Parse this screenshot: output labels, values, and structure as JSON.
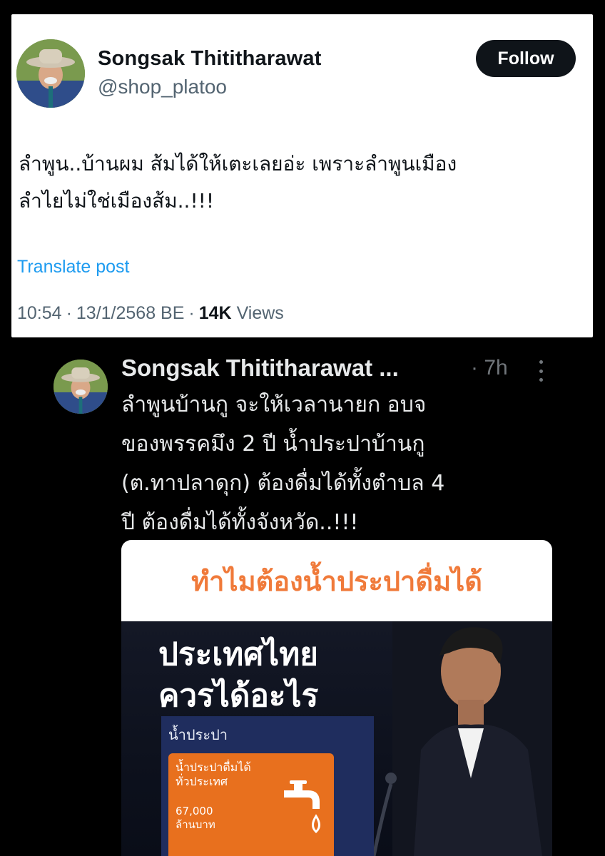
{
  "top_post": {
    "author_name": "Songsak Thititharawat",
    "handle": "@shop_platoo",
    "follow_label": "Follow",
    "text_line1": "ลำพูน..บ้านผม ส้มได้ให้เตะเลยอ่ะ เพราะลำพูนเมือง",
    "text_line2": "ลำไยไม่ใช่เมืองส้ม..!!!",
    "translate_label": "Translate post",
    "time": "10:54",
    "date": "13/1/2568 BE",
    "views_count": "14K",
    "views_label": "Views",
    "separator": "·"
  },
  "reply_post": {
    "author_name": "Songsak Thititharawat ...",
    "time": "· 7h",
    "text_line1": "ลำพูนบ้านกู จะให้เวลานายก อบจ",
    "text_line2": "ของพรรคมึง 2 ปี น้ำประปาบ้านกู",
    "text_line3": "(ต.ทาปลาดุก) ต้องดื่มได้ทั้งตำบล 4",
    "text_line4": "ปี ต้องดื่มได้ทั้งจังหวัด..!!!",
    "media": {
      "header": "ทำไมต้องน้ำประปาดื่มได้",
      "title_line1": "ประเทศไทย",
      "title_line2": "ควรได้อะไร",
      "panel_label": "น้ำประปา",
      "box_line1": "น้ำประปาดื่มได้",
      "box_line2": "ทั่วประเทศ",
      "box_amount": "67,000",
      "box_unit": "ล้านบาท"
    }
  },
  "colors": {
    "accent_link": "#1d9bf0",
    "follow_bg": "#0f1419",
    "media_header_text": "#f07a3a",
    "orange_box": "#e8701e",
    "panel_blue": "#1f2d5e"
  },
  "icons": [
    "more-options-icon",
    "water-tap-icon"
  ]
}
